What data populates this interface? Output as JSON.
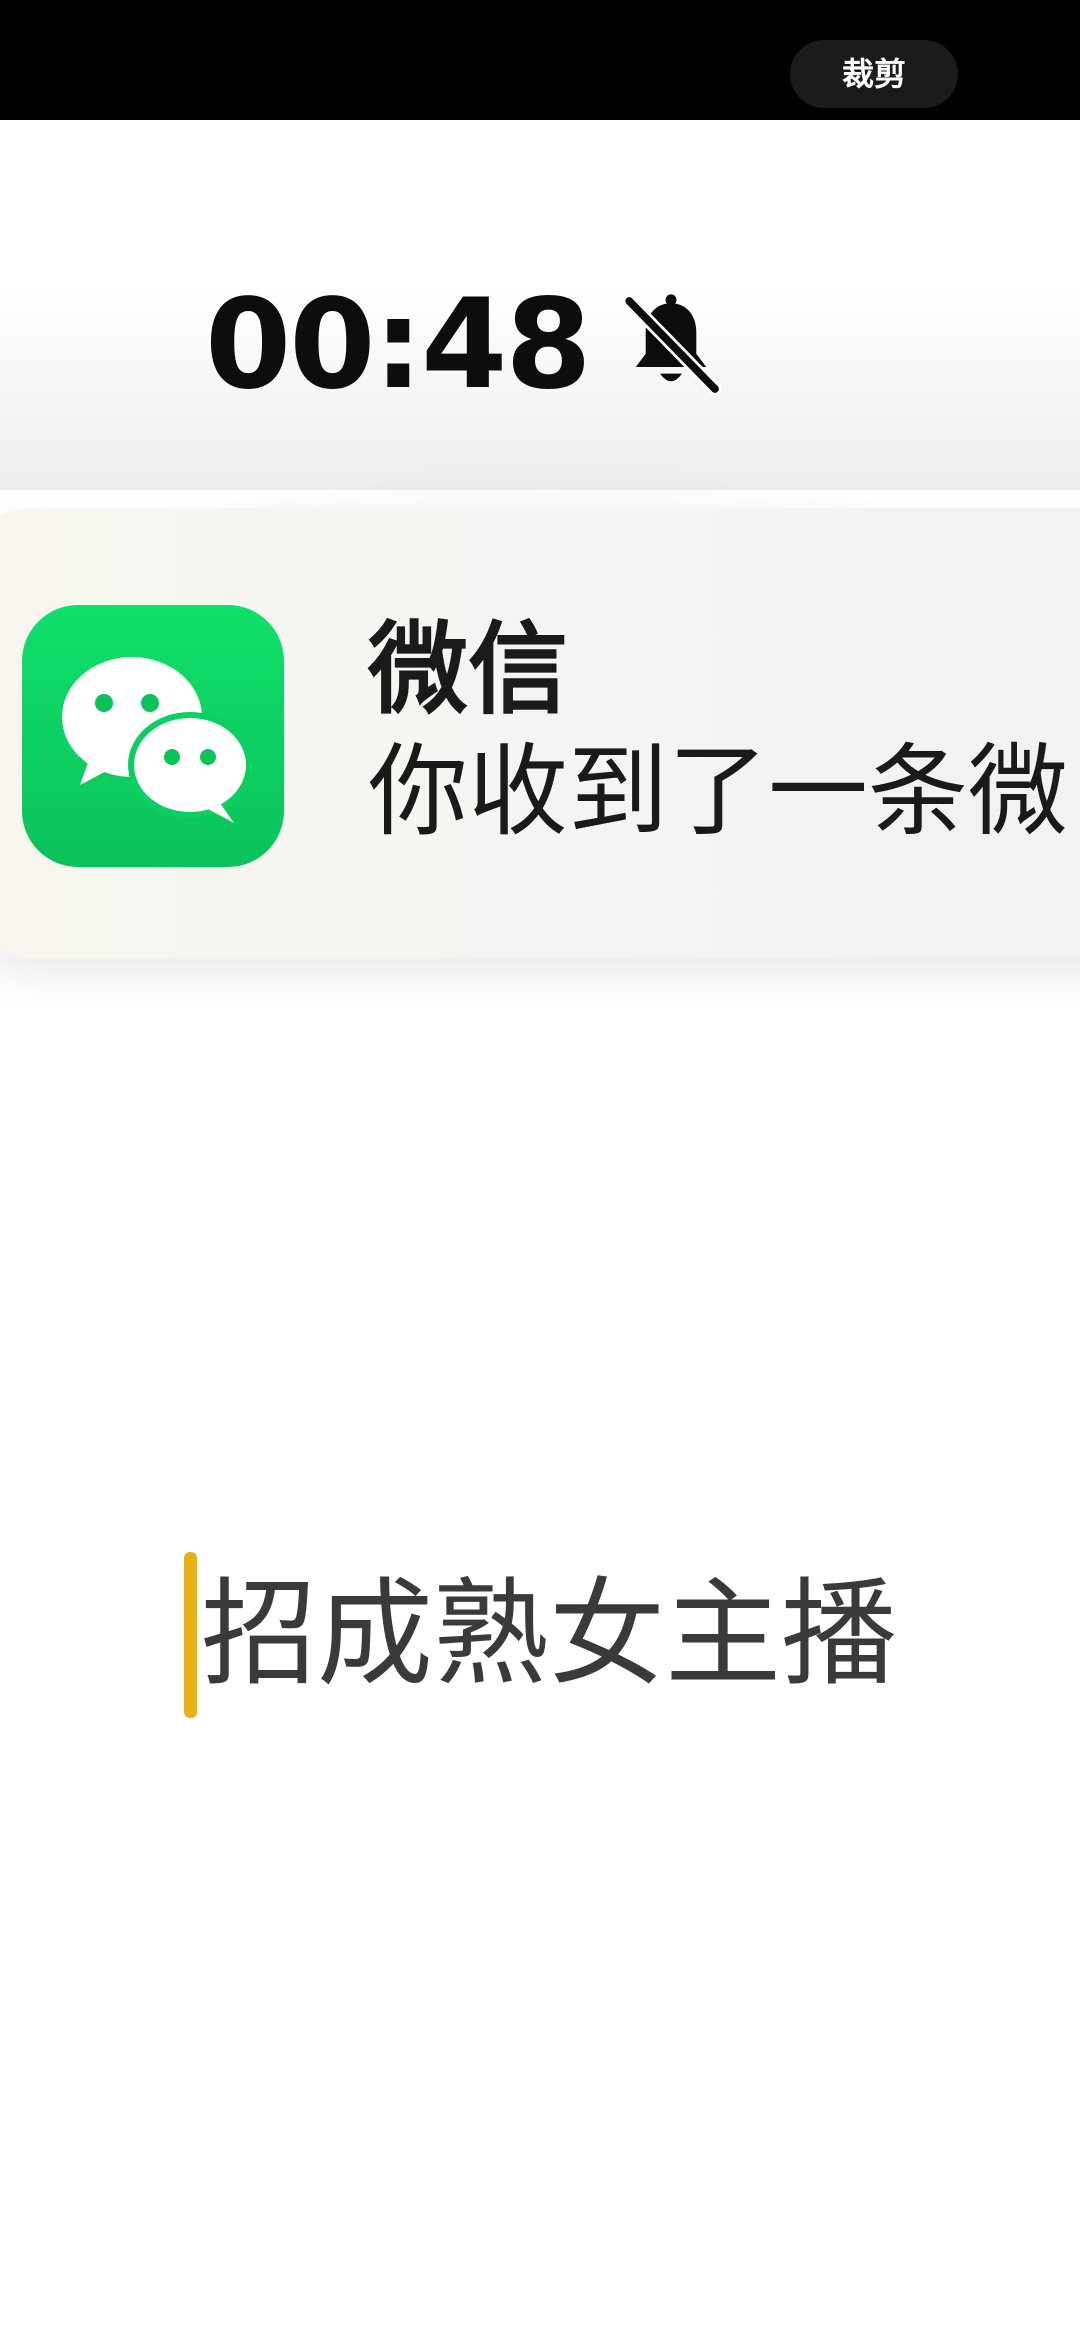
{
  "toolbar": {
    "crop_label": "裁剪"
  },
  "status_bar": {
    "time": "00:48",
    "mute_icon": "bell-slash-icon"
  },
  "notification": {
    "app_icon": "wechat-icon",
    "app_name": "微信",
    "message": "你收到了一条微"
  },
  "caption": {
    "text": "招成熟女主播"
  },
  "colors": {
    "toolbar_bg": "#000000",
    "crop_button_bg": "#1b1b1b",
    "wechat_green": "#0ac25a",
    "cursor": "#e6b215",
    "text": "#1a1a1a"
  }
}
